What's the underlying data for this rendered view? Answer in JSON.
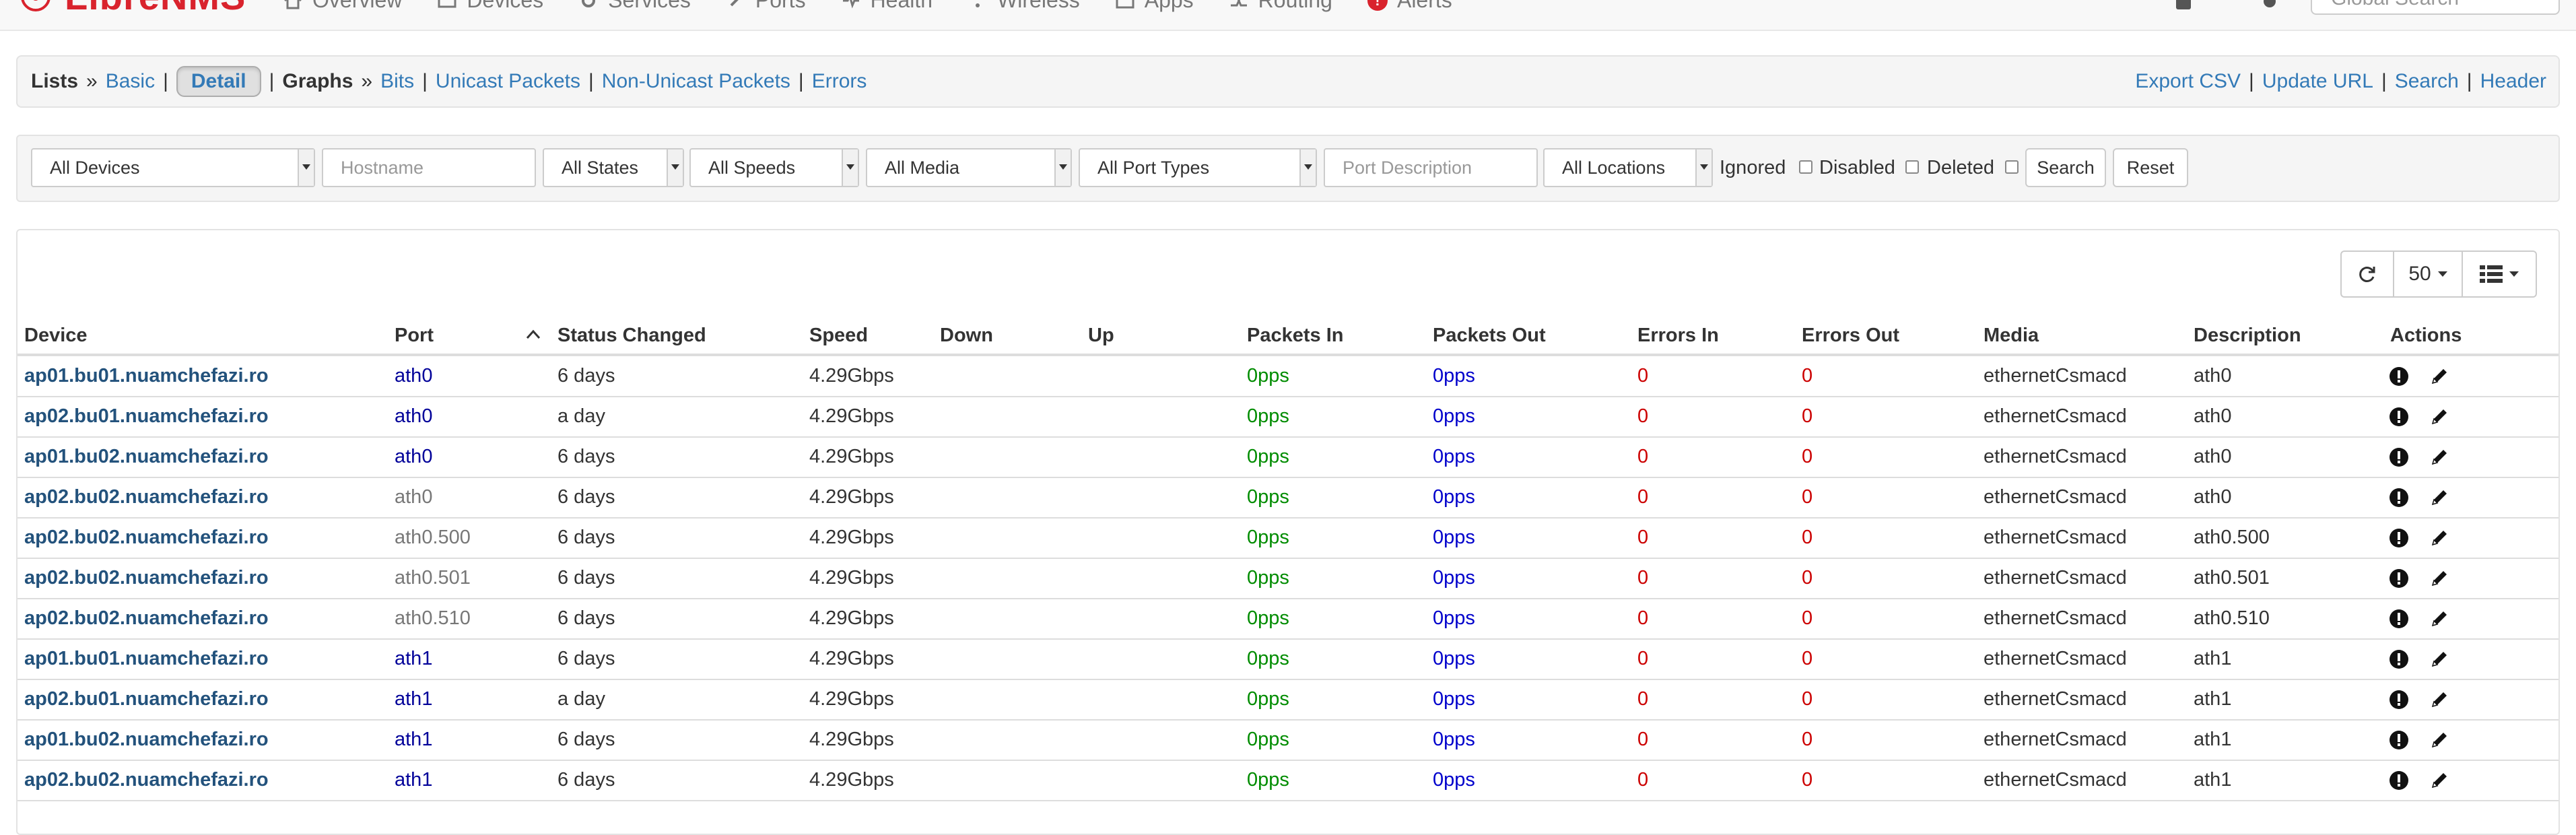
{
  "navbar": {
    "brand": "LibreNMS",
    "items": [
      {
        "label": "Overview",
        "icon": "home-icon"
      },
      {
        "label": "Devices",
        "icon": "server-icon"
      },
      {
        "label": "Services",
        "icon": "cogs-icon"
      },
      {
        "label": "Ports",
        "icon": "link-icon"
      },
      {
        "label": "Health",
        "icon": "heartbeat-icon"
      },
      {
        "label": "Wireless",
        "icon": "wifi-icon"
      },
      {
        "label": "Apps",
        "icon": "tasks-icon"
      },
      {
        "label": "Routing",
        "icon": "random-icon"
      },
      {
        "label": "Alerts",
        "icon": "alert-icon"
      }
    ],
    "global_search_placeholder": "Global Search"
  },
  "lists_bar": {
    "lists_label": "Lists",
    "raquo": "»",
    "basic": "Basic",
    "detail": "Detail",
    "graphs_label": "Graphs",
    "bits": "Bits",
    "unicast": "Unicast Packets",
    "non_unicast": "Non-Unicast Packets",
    "errors": "Errors",
    "export_csv": "Export CSV",
    "update_url": "Update URL",
    "search": "Search",
    "header": "Header",
    "sep": "|"
  },
  "filters": {
    "devices": "All Devices",
    "hostname_placeholder": "Hostname",
    "states": "All States",
    "speeds": "All Speeds",
    "media": "All Media",
    "port_types": "All Port Types",
    "port_description_placeholder": "Port Description",
    "locations": "All Locations",
    "ignored": "Ignored",
    "disabled": "Disabled",
    "deleted": "Deleted",
    "search_button": "Search",
    "reset_button": "Reset"
  },
  "toolbar": {
    "page_size": "50"
  },
  "table": {
    "columns": [
      "Device",
      "Port",
      "Status Changed",
      "Speed",
      "Down",
      "Up",
      "Packets In",
      "Packets Out",
      "Errors In",
      "Errors Out",
      "Media",
      "Description",
      "Actions"
    ],
    "rows": [
      {
        "device": "ap01.bu01.nuamchefazi.ro",
        "port": "ath0",
        "port_state": "up",
        "status": "6 days",
        "speed": "4.29Gbps",
        "pin": "0pps",
        "pout": "0pps",
        "ein": "0",
        "eout": "0",
        "media": "ethernetCsmacd",
        "desc": "ath0"
      },
      {
        "device": "ap02.bu01.nuamchefazi.ro",
        "port": "ath0",
        "port_state": "up",
        "status": "a day",
        "speed": "4.29Gbps",
        "pin": "0pps",
        "pout": "0pps",
        "ein": "0",
        "eout": "0",
        "media": "ethernetCsmacd",
        "desc": "ath0"
      },
      {
        "device": "ap01.bu02.nuamchefazi.ro",
        "port": "ath0",
        "port_state": "up",
        "status": "6 days",
        "speed": "4.29Gbps",
        "pin": "0pps",
        "pout": "0pps",
        "ein": "0",
        "eout": "0",
        "media": "ethernetCsmacd",
        "desc": "ath0"
      },
      {
        "device": "ap02.bu02.nuamchefazi.ro",
        "port": "ath0",
        "port_state": "down",
        "status": "6 days",
        "speed": "4.29Gbps",
        "pin": "0pps",
        "pout": "0pps",
        "ein": "0",
        "eout": "0",
        "media": "ethernetCsmacd",
        "desc": "ath0"
      },
      {
        "device": "ap02.bu02.nuamchefazi.ro",
        "port": "ath0.500",
        "port_state": "down",
        "status": "6 days",
        "speed": "4.29Gbps",
        "pin": "0pps",
        "pout": "0pps",
        "ein": "0",
        "eout": "0",
        "media": "ethernetCsmacd",
        "desc": "ath0.500"
      },
      {
        "device": "ap02.bu02.nuamchefazi.ro",
        "port": "ath0.501",
        "port_state": "down",
        "status": "6 days",
        "speed": "4.29Gbps",
        "pin": "0pps",
        "pout": "0pps",
        "ein": "0",
        "eout": "0",
        "media": "ethernetCsmacd",
        "desc": "ath0.501"
      },
      {
        "device": "ap02.bu02.nuamchefazi.ro",
        "port": "ath0.510",
        "port_state": "down",
        "status": "6 days",
        "speed": "4.29Gbps",
        "pin": "0pps",
        "pout": "0pps",
        "ein": "0",
        "eout": "0",
        "media": "ethernetCsmacd",
        "desc": "ath0.510"
      },
      {
        "device": "ap01.bu01.nuamchefazi.ro",
        "port": "ath1",
        "port_state": "up",
        "status": "6 days",
        "speed": "4.29Gbps",
        "pin": "0pps",
        "pout": "0pps",
        "ein": "0",
        "eout": "0",
        "media": "ethernetCsmacd",
        "desc": "ath1"
      },
      {
        "device": "ap02.bu01.nuamchefazi.ro",
        "port": "ath1",
        "port_state": "up",
        "status": "a day",
        "speed": "4.29Gbps",
        "pin": "0pps",
        "pout": "0pps",
        "ein": "0",
        "eout": "0",
        "media": "ethernetCsmacd",
        "desc": "ath1"
      },
      {
        "device": "ap01.bu02.nuamchefazi.ro",
        "port": "ath1",
        "port_state": "up",
        "status": "6 days",
        "speed": "4.29Gbps",
        "pin": "0pps",
        "pout": "0pps",
        "ein": "0",
        "eout": "0",
        "media": "ethernetCsmacd",
        "desc": "ath1"
      },
      {
        "device": "ap02.bu02.nuamchefazi.ro",
        "port": "ath1",
        "port_state": "up",
        "status": "6 days",
        "speed": "4.29Gbps",
        "pin": "0pps",
        "pout": "0pps",
        "ein": "0",
        "eout": "0",
        "media": "ethernetCsmacd",
        "desc": "ath1"
      }
    ]
  },
  "colors": {
    "port_up": "#000099",
    "port_down": "#777777",
    "link": "#337ab7",
    "device_link": "#23527c",
    "packets_in": "#008c00",
    "packets_out": "#0000cc",
    "errors": "#cc0000",
    "brand": "#d9232d"
  }
}
